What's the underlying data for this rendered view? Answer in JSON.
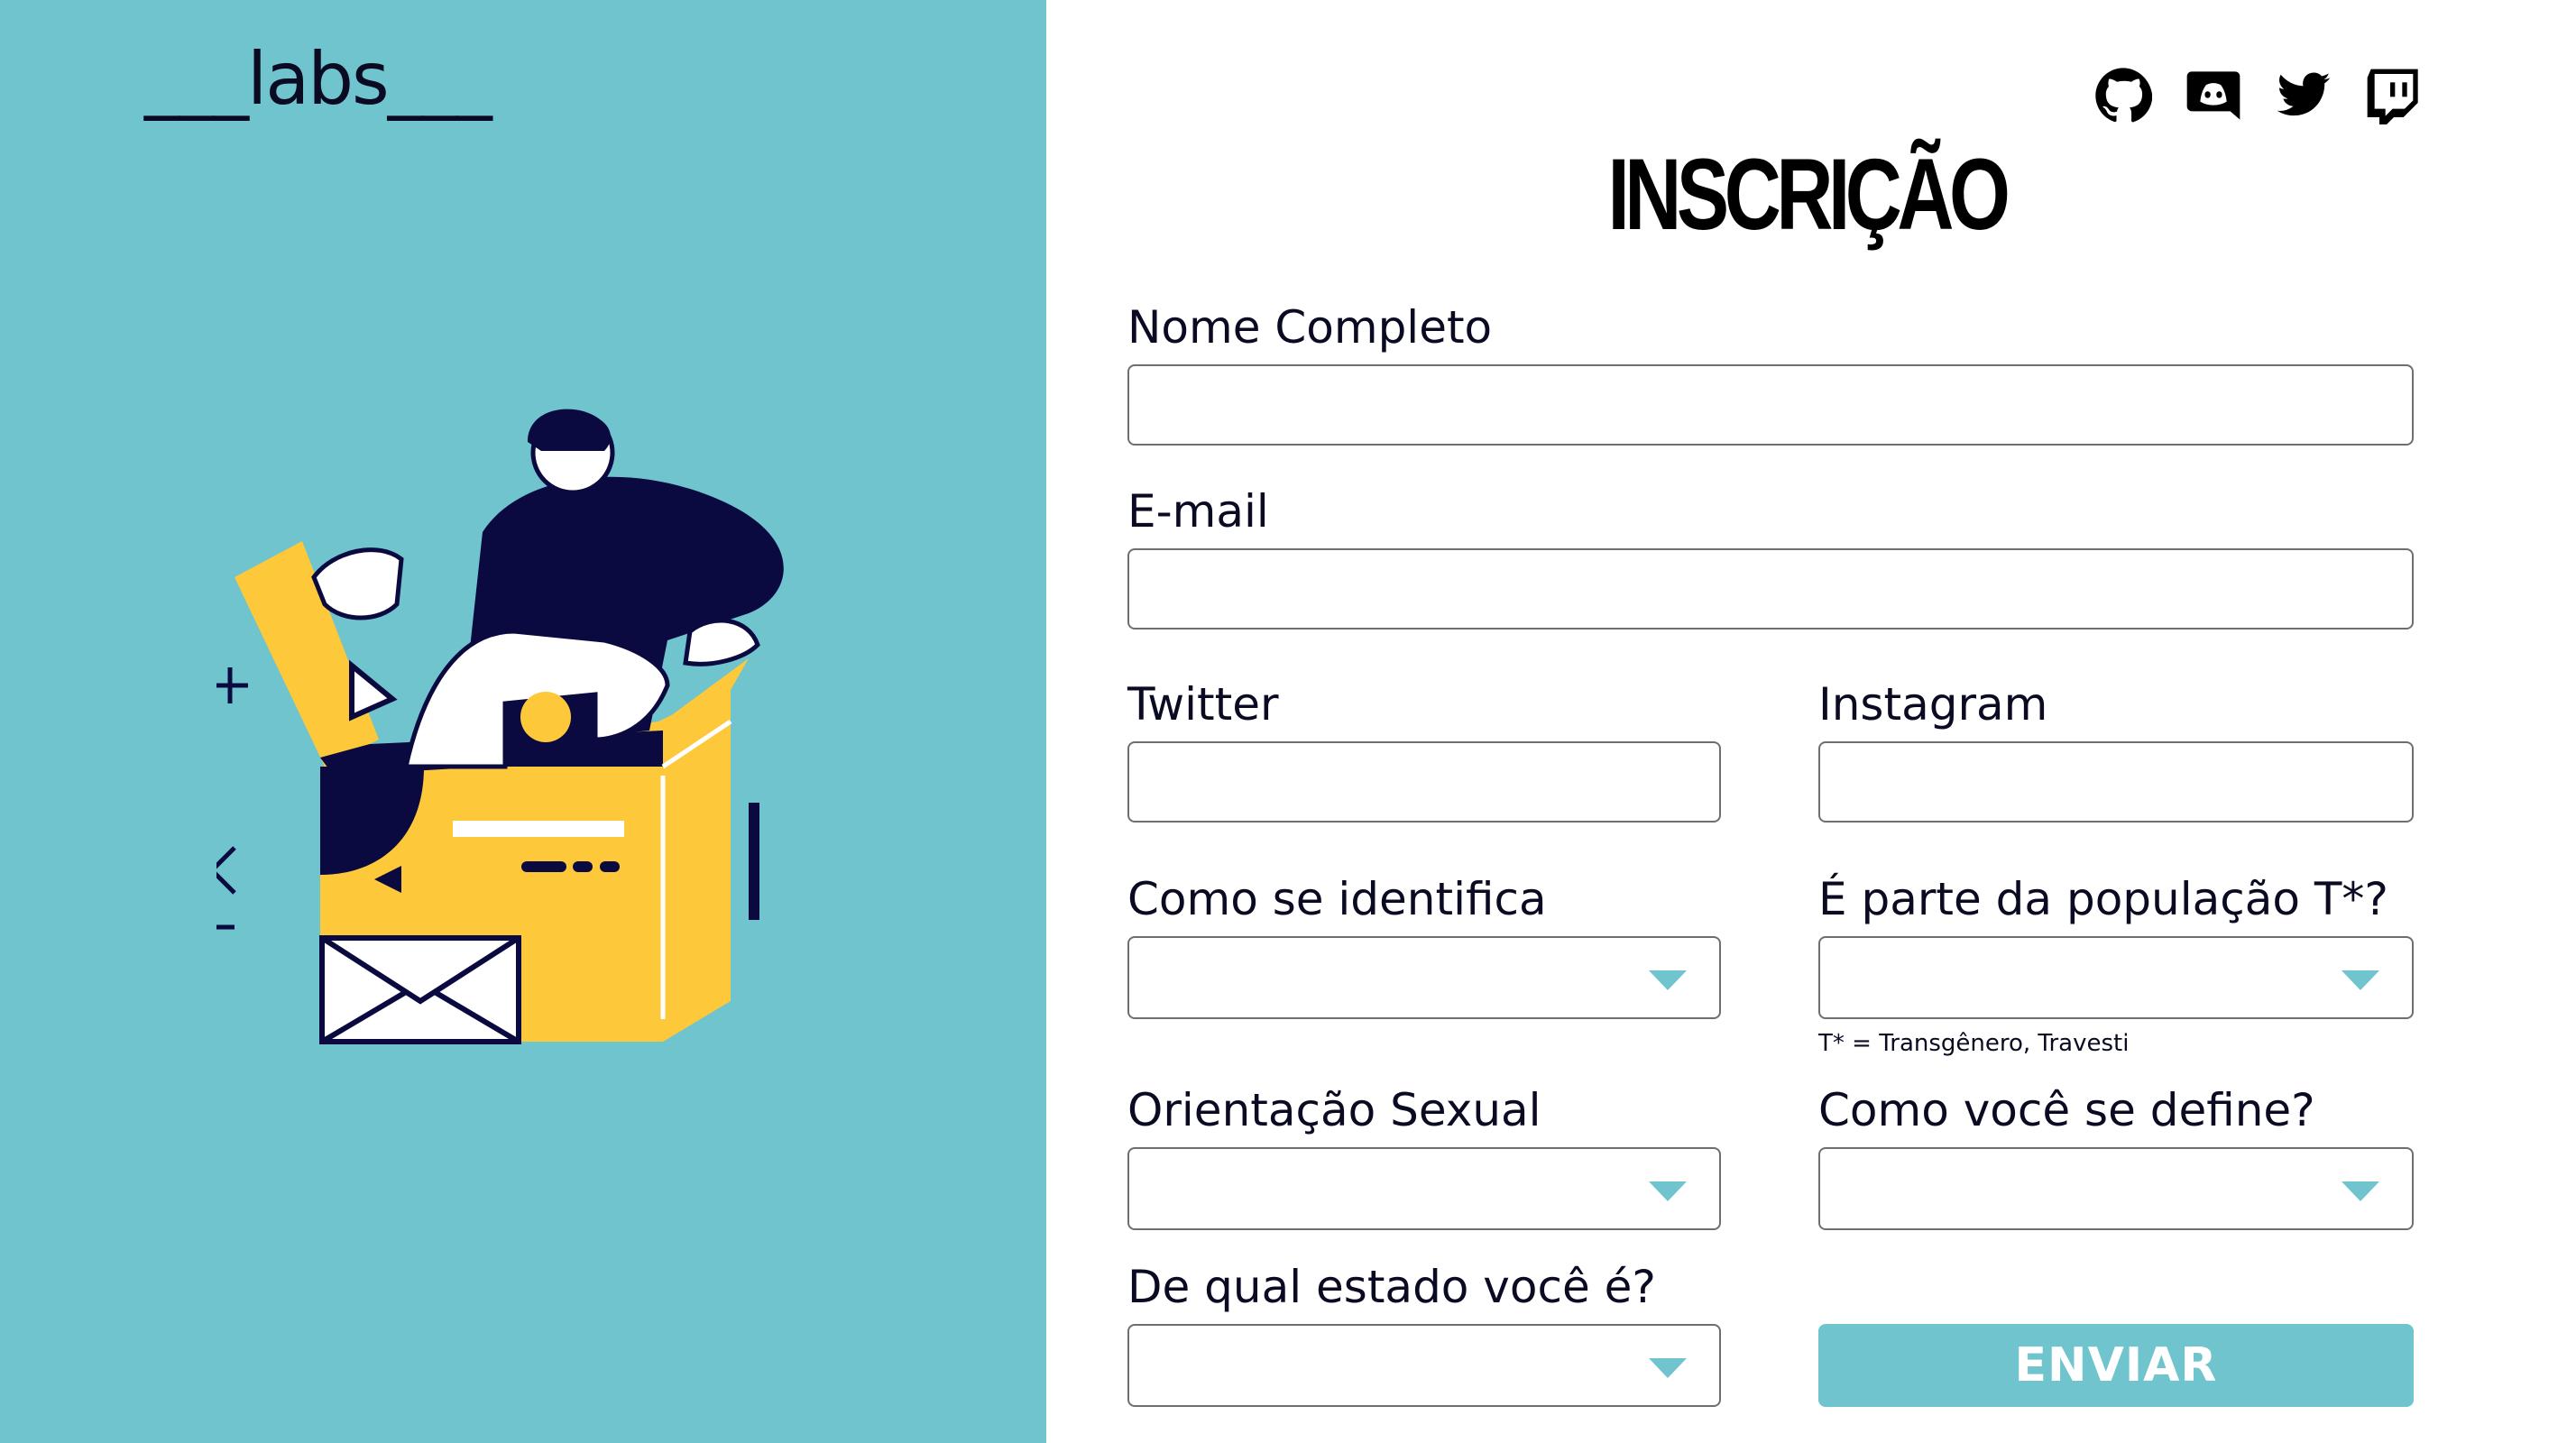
{
  "brand": {
    "logo_text": "___labs___"
  },
  "social": [
    {
      "icon": "github-icon"
    },
    {
      "icon": "discord-icon"
    },
    {
      "icon": "twitter-icon"
    },
    {
      "icon": "twitch-icon"
    }
  ],
  "form": {
    "title": "INSCRIÇÃO",
    "full_name": {
      "label": "Nome Completo",
      "value": ""
    },
    "email": {
      "label": "E-mail",
      "value": ""
    },
    "twitter": {
      "label": "Twitter",
      "value": ""
    },
    "instagram": {
      "label": "Instagram",
      "value": ""
    },
    "identity": {
      "label": "Como se identifica",
      "value": ""
    },
    "trans": {
      "label": "É parte da população T*?",
      "value": "",
      "hint": "T* = Transgênero, Travesti"
    },
    "orientation": {
      "label": "Orientação Sexual",
      "value": ""
    },
    "define": {
      "label": "Como você se define?",
      "value": ""
    },
    "state": {
      "label": "De qual estado você é?",
      "value": ""
    },
    "submit_label": "ENVIAR"
  },
  "colors": {
    "accent": "#6fc4cd",
    "navy": "#0a0a40",
    "yellow": "#fdc93a"
  }
}
